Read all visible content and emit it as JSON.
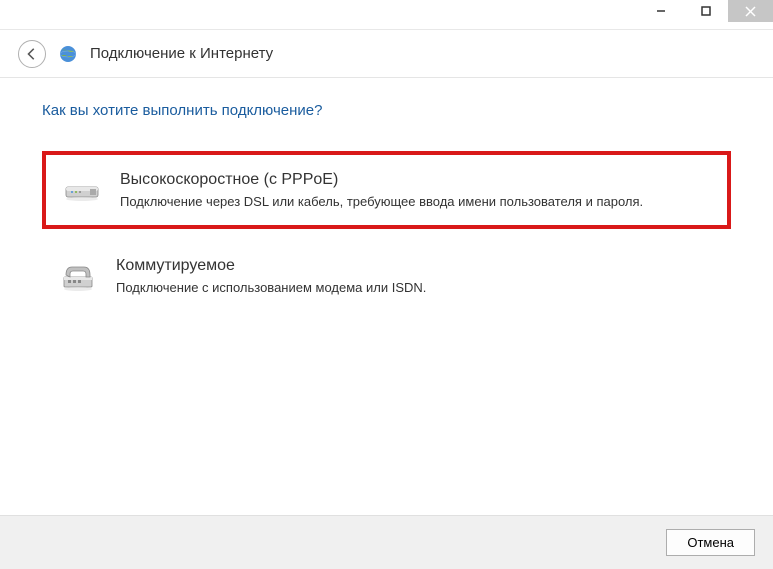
{
  "window": {
    "title": "Подключение к Интернету"
  },
  "main": {
    "question": "Как вы хотите выполнить подключение?"
  },
  "options": [
    {
      "title": "Высокоскоростное (с PPPoE)",
      "description": "Подключение через DSL или кабель, требующее ввода имени пользователя и пароля."
    },
    {
      "title": "Коммутируемое",
      "description": "Подключение с использованием модема или ISDN."
    }
  ],
  "footer": {
    "cancel_label": "Отмена"
  }
}
